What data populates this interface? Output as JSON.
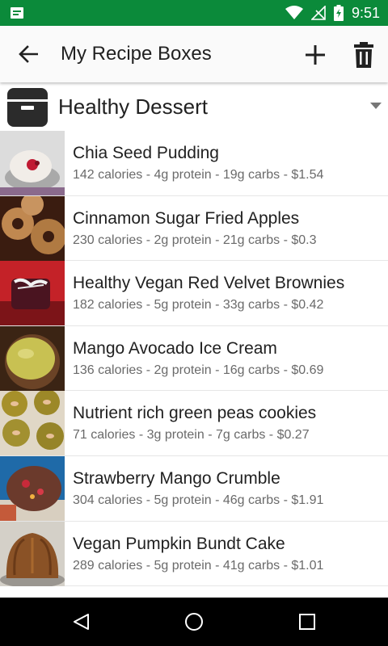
{
  "status_bar": {
    "time": "9:51",
    "icons": [
      "notification-icon",
      "wifi-icon",
      "no-signal-icon",
      "battery-icon"
    ]
  },
  "app_bar": {
    "title": "My Recipe Boxes",
    "icons": [
      "back-arrow-icon",
      "add-icon",
      "trash-icon"
    ]
  },
  "recipe_box": {
    "name": "Healthy Dessert",
    "icon": "recipe-box-icon"
  },
  "recipes": [
    {
      "name": "Chia Seed Pudding",
      "stats": "142 calories - 4g protein - 19g carbs - $1.54"
    },
    {
      "name": "Cinnamon Sugar Fried Apples",
      "stats": "230 calories - 2g protein - 21g carbs - $0.3"
    },
    {
      "name": "Healthy Vegan Red Velvet Brownies",
      "stats": "182 calories - 5g protein - 33g carbs - $0.42"
    },
    {
      "name": "Mango Avocado Ice Cream",
      "stats": "136 calories - 2g protein - 16g carbs - $0.69"
    },
    {
      "name": "Nutrient rich green peas cookies",
      "stats": "71 calories - 3g protein - 7g carbs - $0.27"
    },
    {
      "name": "Strawberry Mango Crumble",
      "stats": "304 calories - 5g protein - 46g carbs - $1.91"
    },
    {
      "name": "Vegan Pumpkin Bundt Cake",
      "stats": "289 calories - 5g protein - 41g carbs - $1.01"
    }
  ],
  "nav_bar": {
    "icons": [
      "back-triangle-icon",
      "home-circle-icon",
      "recents-square-icon"
    ]
  },
  "colors": {
    "status_bar": "#0b8a3a",
    "app_bar": "#fafafa",
    "text_primary": "#212121",
    "text_secondary": "#6a6a6a"
  }
}
